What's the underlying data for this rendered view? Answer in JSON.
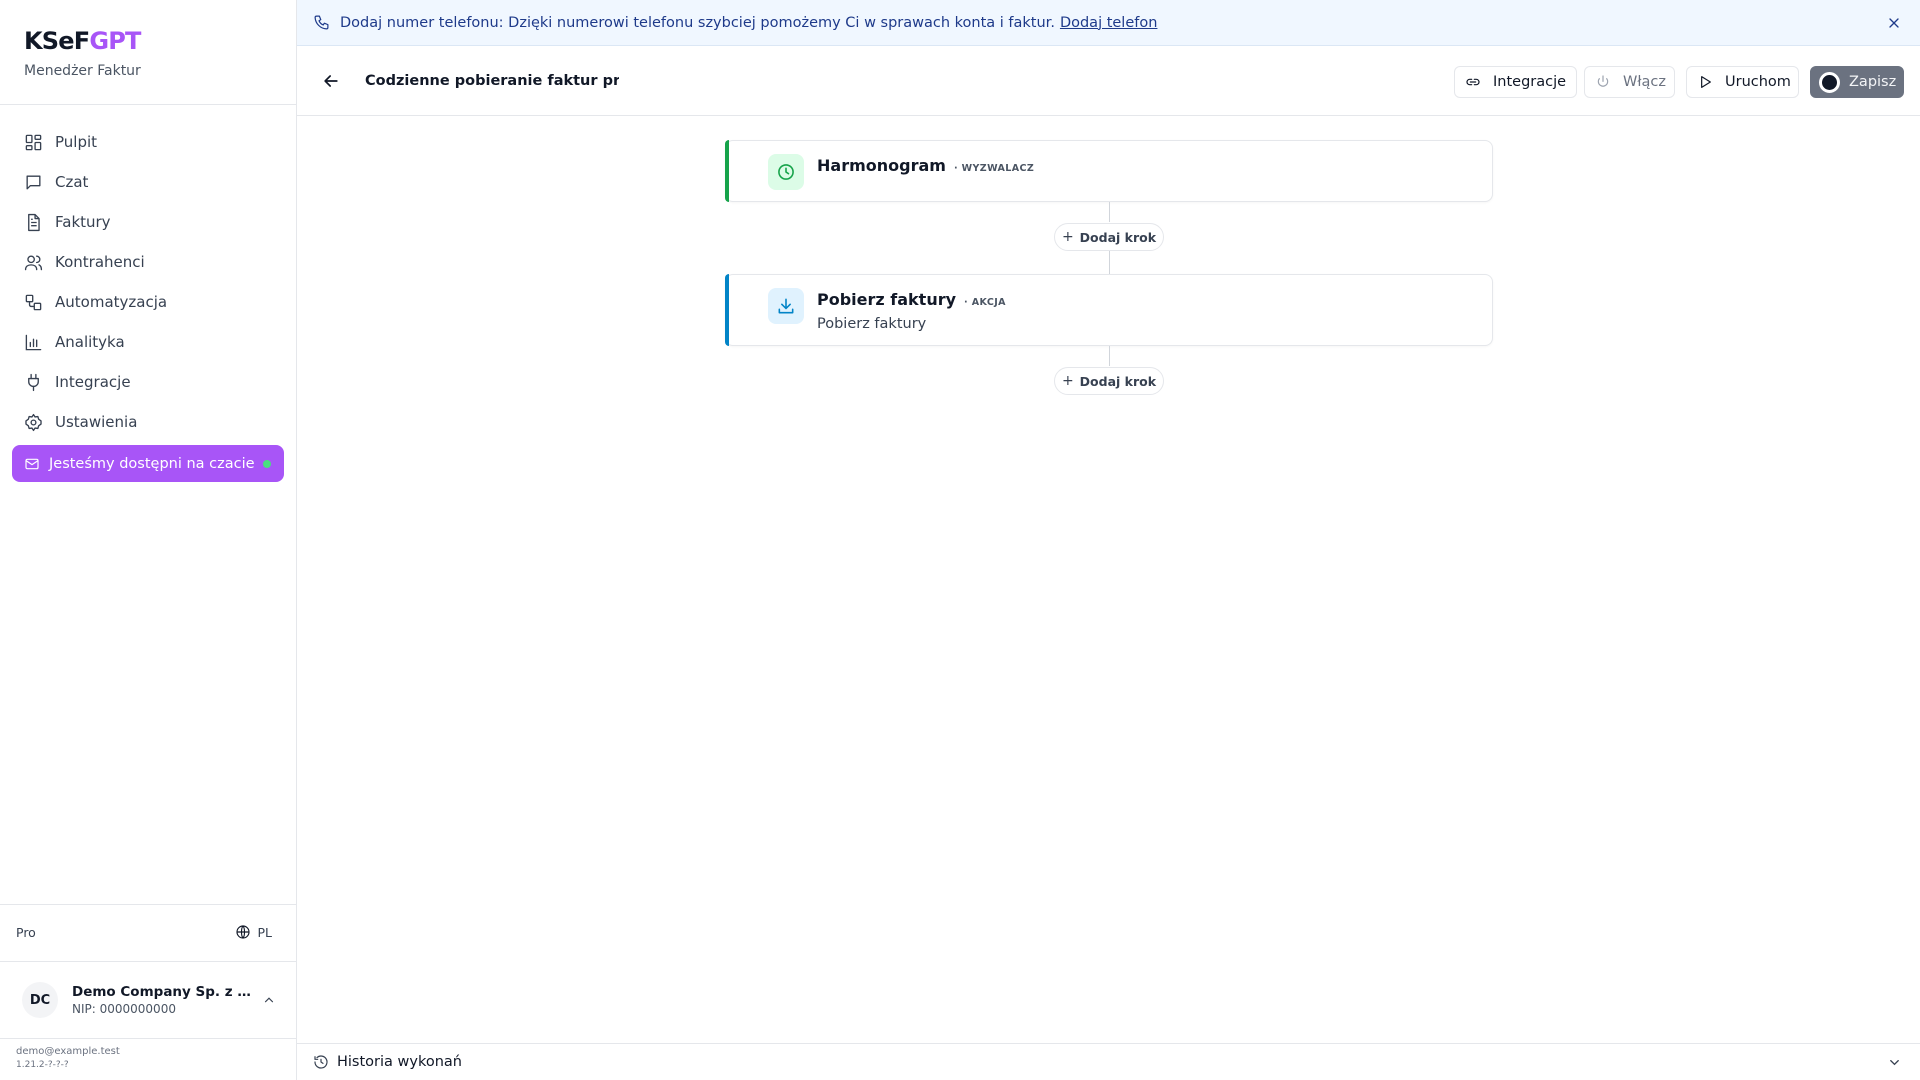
{
  "brand": {
    "logo_left": "KSeF",
    "logo_right": "GPT",
    "subtitle": "Menedżer Faktur",
    "accent": "#a855f7"
  },
  "sidebar": {
    "items": [
      {
        "label": "Pulpit",
        "icon": "dashboard-icon"
      },
      {
        "label": "Czat",
        "icon": "chat-icon"
      },
      {
        "label": "Faktury",
        "icon": "document-icon"
      },
      {
        "label": "Kontrahenci",
        "icon": "users-icon"
      },
      {
        "label": "Automatyzacja",
        "icon": "workflow-icon"
      },
      {
        "label": "Analityka",
        "icon": "bar-chart-icon"
      },
      {
        "label": "Integracje",
        "icon": "plug-icon"
      },
      {
        "label": "Ustawienia",
        "icon": "gear-icon"
      }
    ],
    "chat_cta": "Jesteśmy dostępni na czacie",
    "plan": "Pro",
    "language": "PL",
    "company": {
      "initials": "DC",
      "name": "Demo Company Sp. z o.o.",
      "nip": "NIP: 0000000000"
    },
    "footer": {
      "email": "demo@example.test",
      "version": "1.21.2-?-?-?"
    }
  },
  "banner": {
    "text": "Dodaj numer telefonu: Dzięki numerowi telefonu szybciej pomożemy Ci w sprawach konta i faktur.",
    "link": "Dodaj telefon"
  },
  "header": {
    "title": "Codzienne pobieranie faktur przychodzących",
    "buttons": {
      "integrations": "Integracje",
      "enable": "Włącz",
      "run": "Uruchom",
      "save": "Zapisz"
    }
  },
  "steps": [
    {
      "title": "Harmonogram",
      "kind": "· WYZWALACZ",
      "description": "",
      "color": "#16a34a"
    },
    {
      "title": "Pobierz faktury",
      "kind": "· AKCJA",
      "description": "Pobierz faktury",
      "color": "#0284c7"
    }
  ],
  "add_step_label": "Dodaj krok",
  "history": {
    "label": "Historia wykonań"
  }
}
